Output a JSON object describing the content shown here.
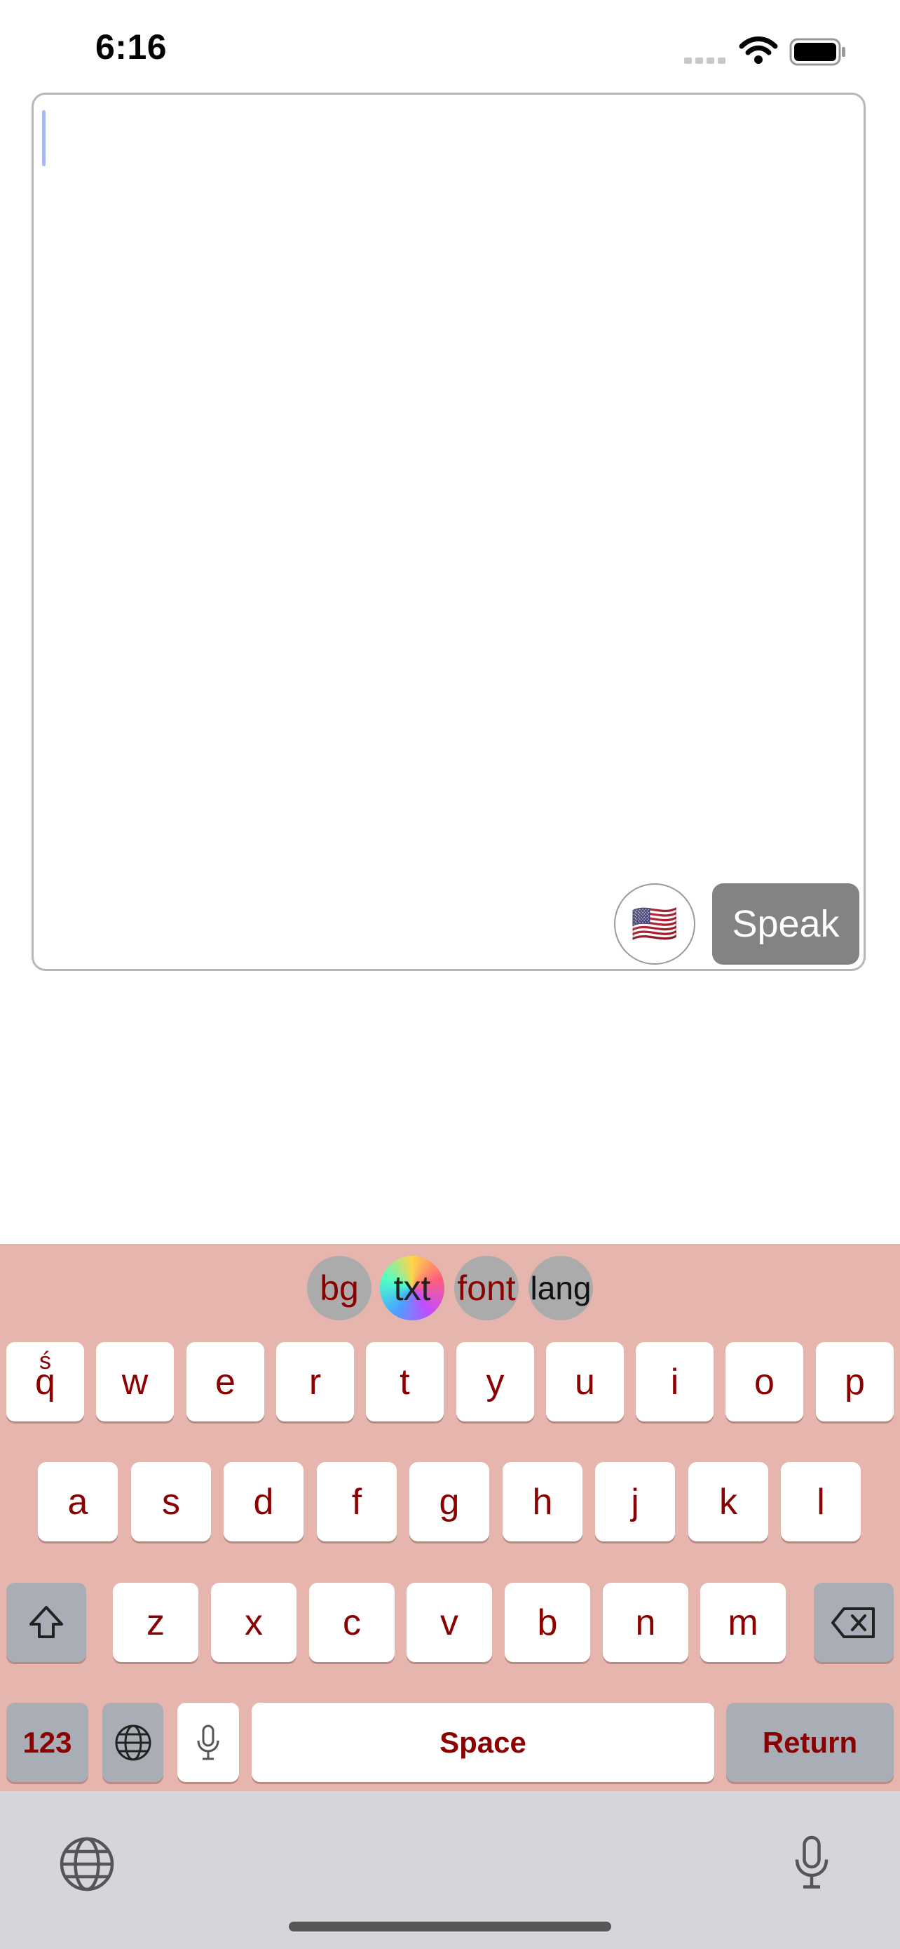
{
  "status": {
    "time": "6:16"
  },
  "text_input": {
    "value": ""
  },
  "buttons": {
    "flag_emoji": "🇺🇸",
    "speak": "Speak"
  },
  "keyboard_toolbar": {
    "bg": "bg",
    "txt": "txt",
    "font": "font",
    "lang": "lang"
  },
  "rows": {
    "row1": [
      "q",
      "w",
      "e",
      "r",
      "t",
      "y",
      "u",
      "i",
      "o",
      "p"
    ],
    "row2": [
      "a",
      "s",
      "d",
      "f",
      "g",
      "h",
      "j",
      "k",
      "l"
    ],
    "row3": [
      "z",
      "x",
      "c",
      "v",
      "b",
      "n",
      "m"
    ]
  },
  "bottom_keys": {
    "numbers": "123",
    "space": "Space",
    "return": "Return"
  },
  "colors": {
    "keyboard_bg": "#e6b5ae",
    "key_text": "#8b0000",
    "special_key": "#a9adb6"
  },
  "icons": [
    "wifi-icon",
    "battery-icon",
    "globe-icon",
    "microphone-icon",
    "shift-icon",
    "backspace-icon"
  ]
}
